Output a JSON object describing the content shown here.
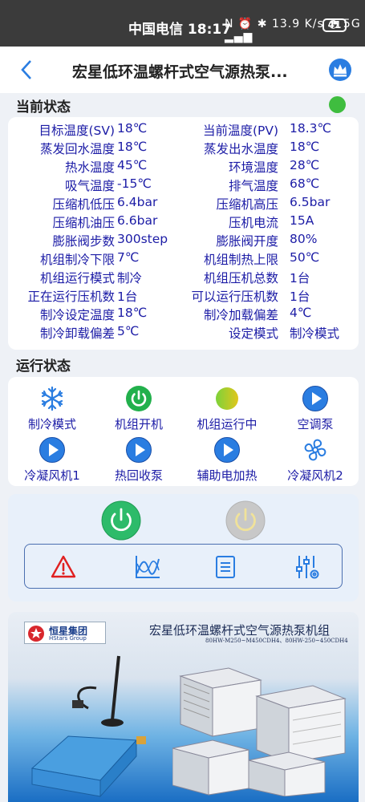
{
  "statusbar": {
    "carrier_time": "中国电信 18:17",
    "icons": "N ⏰ ✱ 13.9 K/s ◔ 5G ▂▄▆",
    "battery": "41"
  },
  "header": {
    "title": "宏星低环温螺杆式空气源热泵..."
  },
  "current_status": {
    "title": "当前状态",
    "indicator_color": "#3fbd3f",
    "rows": [
      {
        "l1": "目标温度(SV)",
        "v1": "18℃",
        "l2": "当前温度(PV)",
        "v2": "18.3℃"
      },
      {
        "l1": "蒸发回水温度",
        "v1": "18℃",
        "l2": "蒸发出水温度",
        "v2": "18℃"
      },
      {
        "l1": "热水温度",
        "v1": "45℃",
        "l2": "环境温度",
        "v2": "28℃"
      },
      {
        "l1": "吸气温度",
        "v1": "-15℃",
        "l2": "排气温度",
        "v2": "68℃"
      },
      {
        "l1": "压缩机低压",
        "v1": "6.4bar",
        "l2": "压缩机高压",
        "v2": "6.5bar"
      },
      {
        "l1": "压缩机油压",
        "v1": "6.6bar",
        "l2": "压机电流",
        "v2": "15A"
      },
      {
        "l1": "膨胀阀步数",
        "v1": "300step",
        "l2": "膨胀阀开度",
        "v2": "80%"
      },
      {
        "l1": "机组制冷下限",
        "v1": "7℃",
        "l2": "机组制热上限",
        "v2": "50℃"
      },
      {
        "l1": "机组运行模式",
        "v1": "制冷",
        "l2": "机组压机总数",
        "v2": "1台"
      },
      {
        "l1": "正在运行压机数",
        "v1": "1台",
        "l2": "可以运行压机数",
        "v2": "1台"
      },
      {
        "l1": "制冷设定温度",
        "v1": "18℃",
        "l2": "制冷加载偏差",
        "v2": "4℃"
      },
      {
        "l1": "制冷卸载偏差",
        "v1": "5℃",
        "l2": "设定模式",
        "v2": "制冷模式"
      }
    ]
  },
  "run_status": {
    "title": "运行状态",
    "items": [
      {
        "label": "制冷模式",
        "icon": "snowflake-icon"
      },
      {
        "label": "机组开机",
        "icon": "power-on-icon"
      },
      {
        "label": "机组运行中",
        "icon": "running-indicator-icon"
      },
      {
        "label": "空调泵",
        "icon": "play-icon"
      },
      {
        "label": "冷凝风机1",
        "icon": "play-icon"
      },
      {
        "label": "热回收泵",
        "icon": "play-icon"
      },
      {
        "label": "辅助电加热",
        "icon": "play-icon"
      },
      {
        "label": "冷凝风机2",
        "icon": "fan-icon"
      }
    ]
  },
  "controls": {
    "power_on_color": "#2dbb6a",
    "power_off_color": "#c8c8c8",
    "tools": [
      "alarm-icon",
      "trend-chart-icon",
      "list-icon",
      "settings-sliders-icon"
    ]
  },
  "banner": {
    "brand": "恒星集团",
    "brand_en": "HStars Group",
    "title": "宏星低环温螺杆式空气源热泵机组",
    "models": "80HW-M250~M450CDH4、80HW-250~450CDH4"
  }
}
